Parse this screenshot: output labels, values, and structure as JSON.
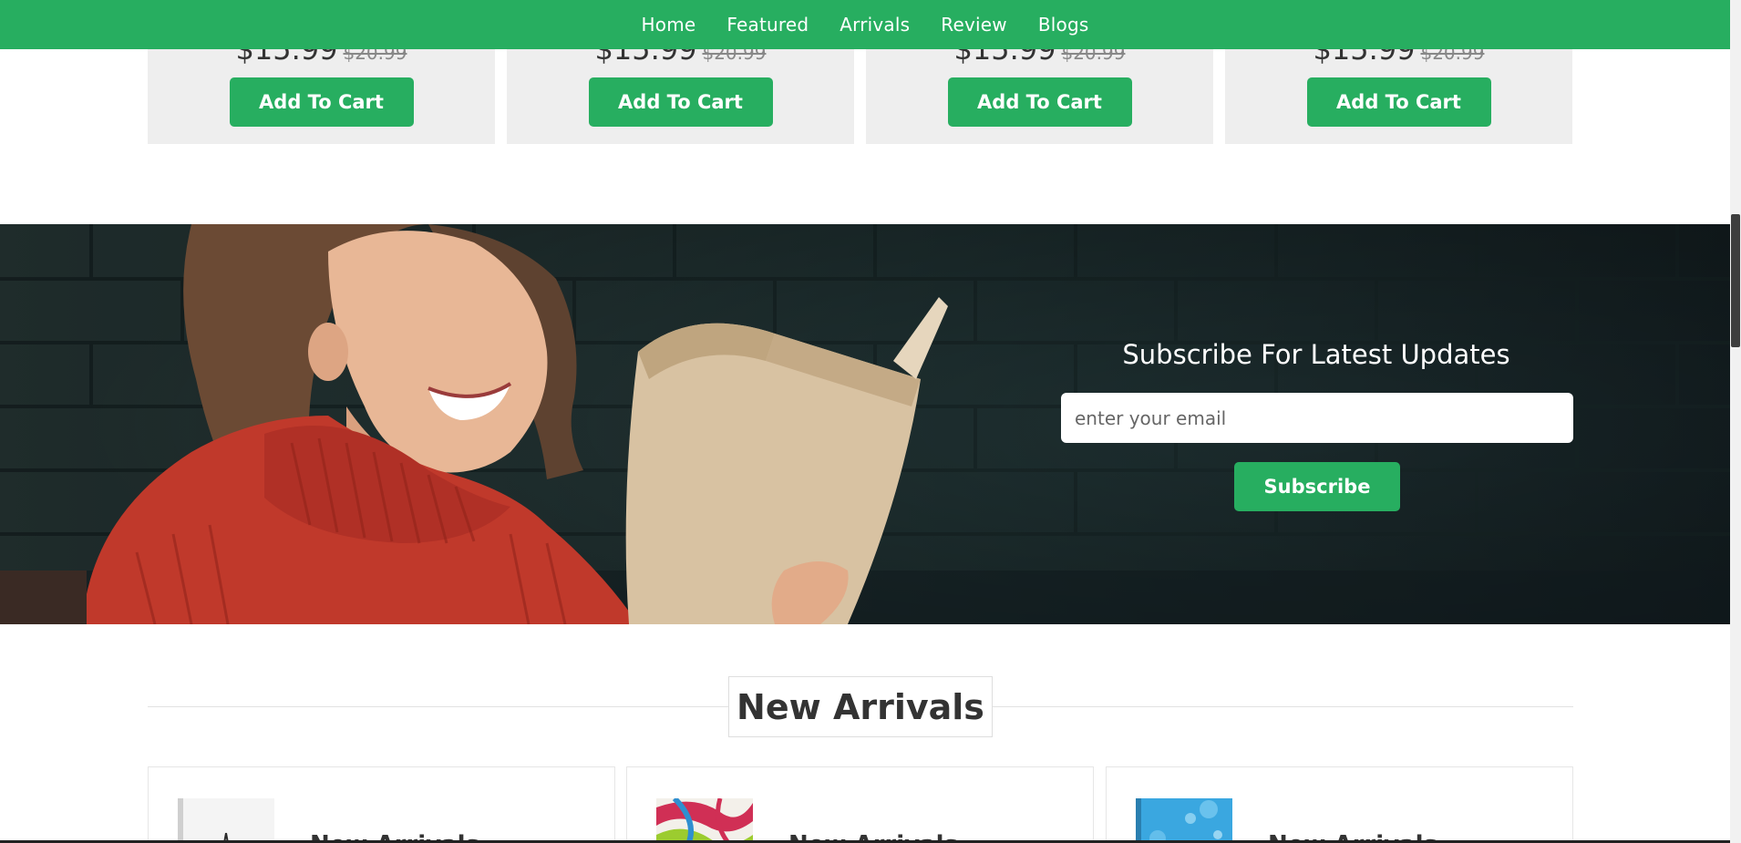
{
  "nav": {
    "items": [
      "Home",
      "Featured",
      "Arrivals",
      "Review",
      "Blogs"
    ]
  },
  "product_cards": [
    {
      "price": "$15.99",
      "old_price": "$20.99",
      "button": "Add To Cart"
    },
    {
      "price": "$15.99",
      "old_price": "$20.99",
      "button": "Add To Cart"
    },
    {
      "price": "$15.99",
      "old_price": "$20.99",
      "button": "Add To Cart"
    },
    {
      "price": "$15.99",
      "old_price": "$20.99",
      "button": "Add To Cart"
    }
  ],
  "newsletter": {
    "title": "Subscribe For Latest Updates",
    "placeholder": "enter your email",
    "button": "Subscribe"
  },
  "arrivals": {
    "heading": "New Arrivals",
    "cards": [
      {
        "title": "New Arrivals",
        "cover": "book-cover-eiffel-icon"
      },
      {
        "title": "New Arrivals",
        "cover": "book-cover-abstract-icon"
      },
      {
        "title": "New Arrivals",
        "cover": "book-cover-bubbles-icon"
      }
    ]
  },
  "colors": {
    "accent": "#27ae60",
    "card_bg": "#eeeeee",
    "text_dark": "#333333"
  }
}
